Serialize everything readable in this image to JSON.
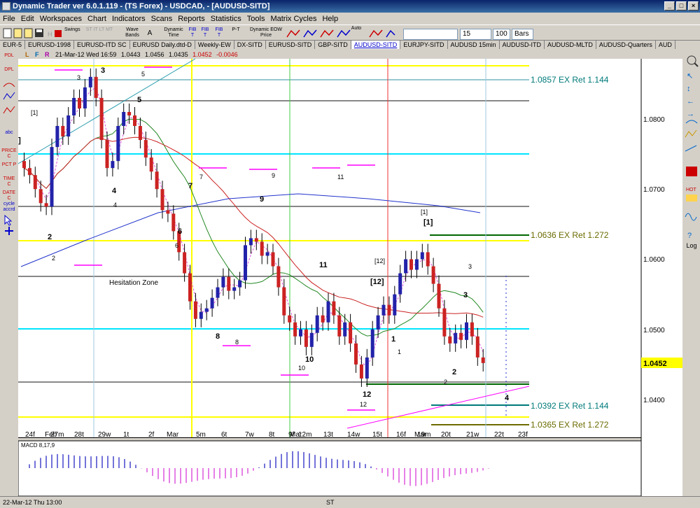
{
  "window": {
    "title": "Dynamic Trader ver 6.0.1.119 - (TS Forex) - USDCAD, - [AUDUSD-SITD]",
    "controls": [
      "_",
      "□",
      "×"
    ]
  },
  "menu": [
    "File",
    "Edit",
    "Workspaces",
    "Chart",
    "Indicators",
    "Scans",
    "Reports",
    "Statistics",
    "Tools",
    "Matrix Cycles",
    "Help"
  ],
  "toolbar": {
    "swings_label": "Swings",
    "swings_sub": "ST IT LT MT",
    "wave_bands_label": "Wave Bands",
    "wave_a": "A",
    "dynamic_time_label": "Dynamic Time",
    "fib_labels": [
      "FIB T",
      "FIB T",
      "FIB T"
    ],
    "pt_label": "P-T",
    "dynamic_eow_label": "Dynamic EOW Price",
    "auto_label": "Auto",
    "bars_count": "15",
    "bars_value": "100",
    "bars_unit": "Bars"
  },
  "tabs": [
    "EUR-5",
    "EURUSD-1998",
    "EURUSD-ITD SC",
    "EURUSD Daily.dtd-D",
    "Weekly-EW",
    "DX-SITD",
    "EURUSD-SITD",
    "GBP-SITD",
    "AUDUSD-SITD",
    "EURJPY-SITD",
    "AUDUSD 15min",
    "AUDUSD-ITD",
    "AUDUSD-MLTD",
    "AUDUSD-Quarters",
    "AUD"
  ],
  "active_tab": "AUDUSD-SITD",
  "left_tools": [
    "PDL",
    "DPL",
    "abc",
    "PRICE C",
    "PCT P",
    "TIME C",
    "DATE C",
    "cycle accrd"
  ],
  "right_tools": [
    "Log"
  ],
  "infobar": {
    "flags": [
      "L",
      "F",
      "R"
    ],
    "date": "21-Mar-12 Wed 16:59",
    "open": "1.0443",
    "high": "1.0456",
    "low": "1.0435",
    "close": "1.0452",
    "change": "-0.0046"
  },
  "chart": {
    "price_ticks": [
      "1.0800",
      "1.0700",
      "1.0600",
      "1.0500",
      "1.0400"
    ],
    "current_price": "1.0452",
    "x_labels": [
      "24f",
      "Feb",
      "27m",
      "28t",
      "29w",
      "1t",
      "2f",
      "Mar",
      "5m",
      "6t",
      "7w",
      "8t",
      "9f",
      "Mar",
      "12m",
      "13t",
      "14w",
      "15t",
      "16f",
      "Mar",
      "19m",
      "20t",
      "21w",
      "22t",
      "23f"
    ],
    "annotations": {
      "ex_ret_1": "1.0857 EX Ret 1.144",
      "ex_ret_2": "1.0636 EX Ret 1.272",
      "ex_ret_3": "1.0392 EX Ret 1.144",
      "ex_ret_4": "1.0365 EX Ret 1.272",
      "hesitation": "Hesitation Zone"
    },
    "wave_labels": [
      "1]",
      "[1]",
      "3",
      "3",
      "5",
      "5",
      "4",
      "4",
      "2",
      "2",
      "6",
      "6",
      "7",
      "7",
      "8",
      "8",
      "9",
      "9",
      "10",
      "10",
      "11",
      "11",
      "12",
      "12",
      "[12]",
      "[12]",
      "1",
      "1",
      "[1]",
      "[1]",
      "2",
      "2",
      "3",
      "3",
      "4"
    ],
    "indicator_label": "MACD 8,17,9"
  },
  "status": {
    "left": "22-Mar-12 Thu 13:00",
    "center": "ST"
  },
  "colors": {
    "up_candle": "#2222aa",
    "down_candle": "#cc2222",
    "yellow_line": "#ffff00",
    "cyan_line": "#00e5ff",
    "gray_line": "#888888",
    "green_target": "#006600",
    "teal_text": "#007a7a",
    "olive_text": "#6b6b00",
    "magenta": "#ff00ff",
    "ma_blue": "#2233cc",
    "ma_red": "#cc2222",
    "ma_green": "#228822"
  }
}
